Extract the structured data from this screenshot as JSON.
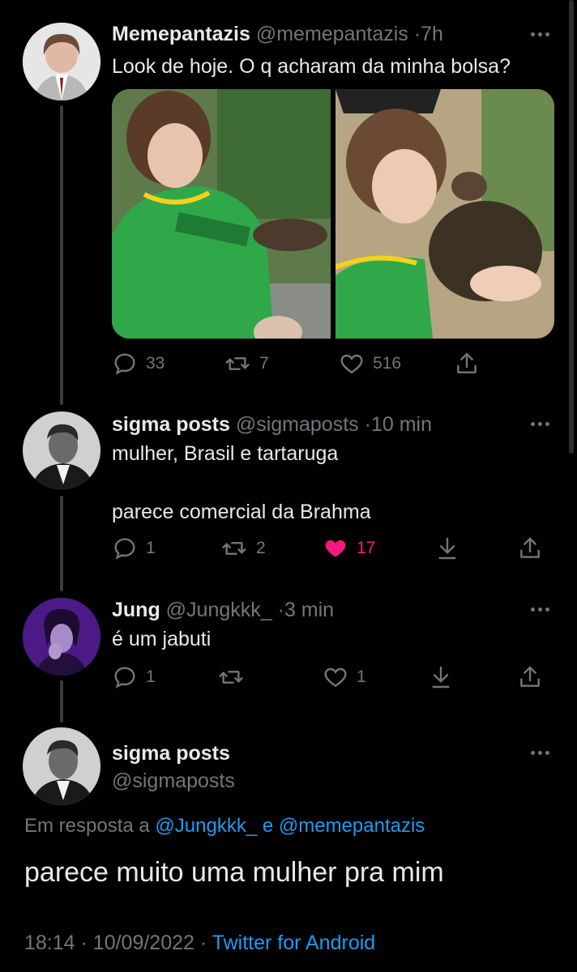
{
  "colors": {
    "background": "#000000",
    "text": "#e7e9ea",
    "muted": "#71767b",
    "accent": "#1d9bf0",
    "like": "#f91880"
  },
  "tweet1": {
    "name": "Memepantazis",
    "handle": "@memepantazis",
    "sep": "·",
    "time": "7h",
    "text": "Look de hoje. O q acharam da minha bolsa?",
    "replies": "33",
    "retweets": "7",
    "likes": "516"
  },
  "tweet2": {
    "name": "sigma posts",
    "handle": "@sigmaposts",
    "sep": "·",
    "time": "10 min",
    "text_line1": "mulher, Brasil e tartaruga",
    "text_line2": "parece comercial da Brahma",
    "replies": "1",
    "retweets": "2",
    "likes": "17",
    "liked": true
  },
  "tweet3": {
    "name": "Jung",
    "handle": "@Jungkkk_",
    "sep": "·",
    "time": "3 min",
    "text": "é um jabuti",
    "replies": "1",
    "retweets": "",
    "likes": "1"
  },
  "main": {
    "name": "sigma posts",
    "handle": "@sigmaposts",
    "reply_prefix": "Em resposta a",
    "reply_mention1": "@Jungkkk_",
    "reply_and": "e",
    "reply_mention2": "@memepantazis",
    "text": "parece muito uma mulher pra mim",
    "time": "18:14",
    "sep1": "·",
    "date": "10/09/2022",
    "sep2": "·",
    "app": "Twitter for Android"
  }
}
